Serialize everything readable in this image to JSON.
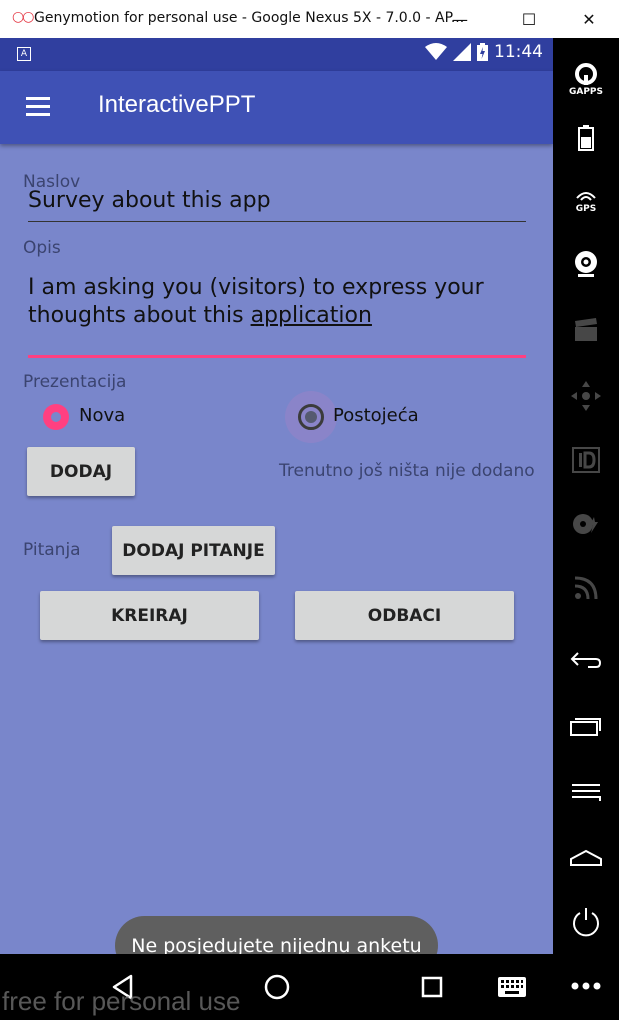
{
  "window": {
    "title": "Genymotion for personal use - Google Nexus 5X - 7.0.0 - AP...",
    "minimize_label": "—",
    "maximize_label": "☐",
    "close_label": "✕"
  },
  "statusbar": {
    "time": "11:44",
    "notification_label": "A"
  },
  "appbar": {
    "title": "InteractivePPT"
  },
  "form": {
    "naslov_label": "Naslov",
    "naslov_value": "Survey about this app",
    "opis_label": "Opis",
    "opis_line1": "I am asking you (visitors) to express your",
    "opis_line2_prefix": "thoughts about this ",
    "opis_line2_underlined": "application",
    "prezentacija_label": "Prezentacija",
    "radio_nova": "Nova",
    "radio_postojeca": "Postojeća",
    "selected_radio": "Nova",
    "dodaj_button": "DODAJ",
    "status_text": "Trenutno još ništa nije dodano",
    "pitanja_label": "Pitanja",
    "dodaj_pitanje_button": "DODAJ PITANJE",
    "kreiraj_button": "KREIRAJ",
    "odbaci_button": "ODBACI"
  },
  "toast": {
    "text": "Ne posjedujete nijednu anketu"
  },
  "watermark": "free for personal use",
  "sidepanel": {
    "gapps_label": "GAPPS",
    "gps_label": "GPS"
  },
  "colors": {
    "primary": "#3F51B5",
    "primary_dark": "#303F9F",
    "background": "#7986CB",
    "accent": "#FF4081"
  }
}
